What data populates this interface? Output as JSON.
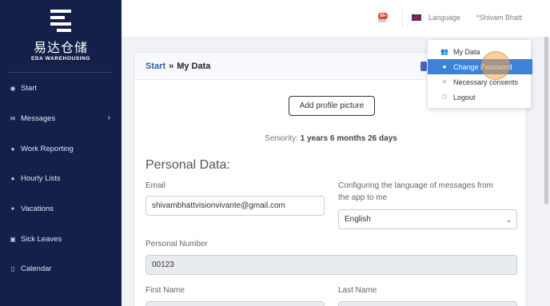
{
  "sidebar": {
    "logo": {
      "cn": "易达仓储",
      "en": "EDA WAREHOUSING"
    },
    "items": [
      {
        "label": "Start",
        "icon": "dashboard-icon"
      },
      {
        "label": "Messages",
        "icon": "envelope-icon"
      },
      {
        "label": "Work Reporting",
        "icon": "clock-icon"
      },
      {
        "label": "Hourly Lists",
        "icon": "clock-icon"
      },
      {
        "label": "Vacations",
        "icon": "palm-icon"
      },
      {
        "label": "Sick Leaves",
        "icon": "briefcase-icon"
      },
      {
        "label": "Calendar",
        "icon": "document-icon"
      }
    ]
  },
  "topbar": {
    "notification_badge": "99+",
    "language_label": "Language",
    "user_name": "*Shivam Bhatt"
  },
  "dropdown": {
    "items": [
      {
        "label": "My Data",
        "icon": "users-icon"
      },
      {
        "label": "Change Password",
        "icon": "user-icon"
      },
      {
        "label": "Necessary consents",
        "icon": "asterisk-icon"
      },
      {
        "label": "Logout",
        "icon": "power-icon"
      }
    ]
  },
  "breadcrumb": {
    "start": "Start",
    "separator": "»",
    "current": "My Data"
  },
  "profile": {
    "add_picture_label": "Add profile picture",
    "seniority_label": "Seniority:",
    "seniority_value": "1 years 6 months 26 days",
    "section_title": "Personal Data:",
    "email_label": "Email",
    "email_value": "shivambhattvisionvivante@gmail.com",
    "language_config_label_1": "Configuring the language of messages from",
    "language_config_label_2": "the app to me",
    "language_selected": "English",
    "personal_number_label": "Personal Number",
    "personal_number_value": "00123",
    "first_name_label": "First Name",
    "last_name_label": "Last Name"
  },
  "colors": {
    "sidebar_bg": "#14204a",
    "accent": "#3d82d6",
    "breadcrumb_link": "#3461a8"
  }
}
